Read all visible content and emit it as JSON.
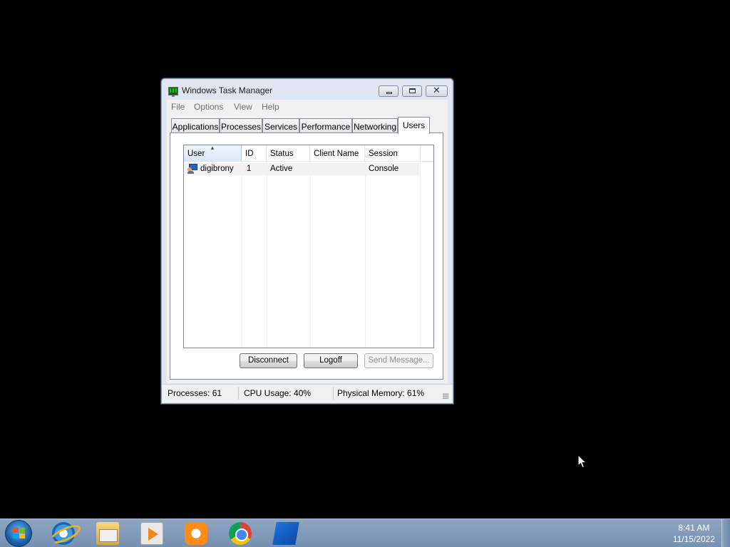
{
  "window": {
    "title": "Windows Task Manager",
    "close_glyph": "✕"
  },
  "menu": [
    "File",
    "Options",
    "View",
    "Help"
  ],
  "tabs": [
    {
      "label": "Applications",
      "active": false
    },
    {
      "label": "Processes",
      "active": false
    },
    {
      "label": "Services",
      "active": false
    },
    {
      "label": "Performance",
      "active": false
    },
    {
      "label": "Networking",
      "active": false
    },
    {
      "label": "Users",
      "active": true
    }
  ],
  "users_table": {
    "columns": [
      "User",
      "ID",
      "Status",
      "Client Name",
      "Session"
    ],
    "sorted_column": "User",
    "sort_indicator": "▲",
    "rows": [
      {
        "user": "digibrony",
        "id": "1",
        "status": "Active",
        "client_name": "",
        "session": "Console"
      }
    ]
  },
  "buttons": {
    "disconnect": "Disconnect",
    "logoff": "Logoff",
    "send_message": "Send Message..."
  },
  "status_bar": {
    "processes": "Processes: 61",
    "cpu": "CPU Usage: 40%",
    "memory": "Physical Memory: 61%"
  },
  "taskbar": {
    "pinned": [
      "start-button",
      "internet-explorer-icon",
      "file-explorer-icon",
      "media-player-icon",
      "uc-browser-icon",
      "chrome-icon",
      "blue-app-icon"
    ],
    "time": "8:41 AM",
    "date": "11/15/2022"
  },
  "colors": {
    "desktop": "#000000",
    "window_frame": "#dde6f1",
    "taskbar": "#7f99b9"
  }
}
